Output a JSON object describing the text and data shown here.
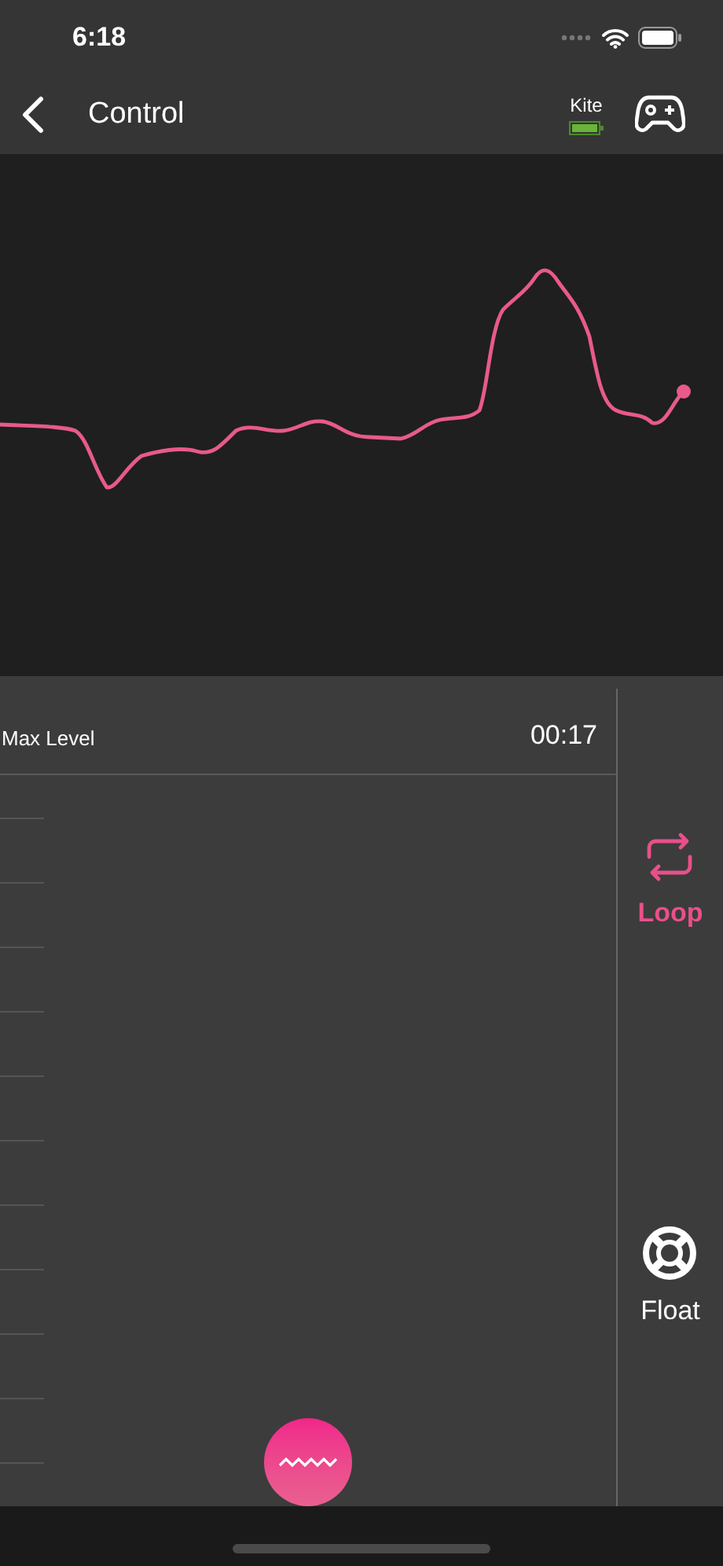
{
  "status_bar": {
    "time": "6:18"
  },
  "nav_bar": {
    "title": "Control",
    "device": {
      "name": "Kite"
    }
  },
  "panel": {
    "label": "Max Level",
    "time": "00:17"
  },
  "side_buttons": [
    {
      "kind": "loop",
      "label": "Loop",
      "selected": true
    },
    {
      "kind": "float",
      "label": "Float",
      "selected": false
    }
  ]
}
